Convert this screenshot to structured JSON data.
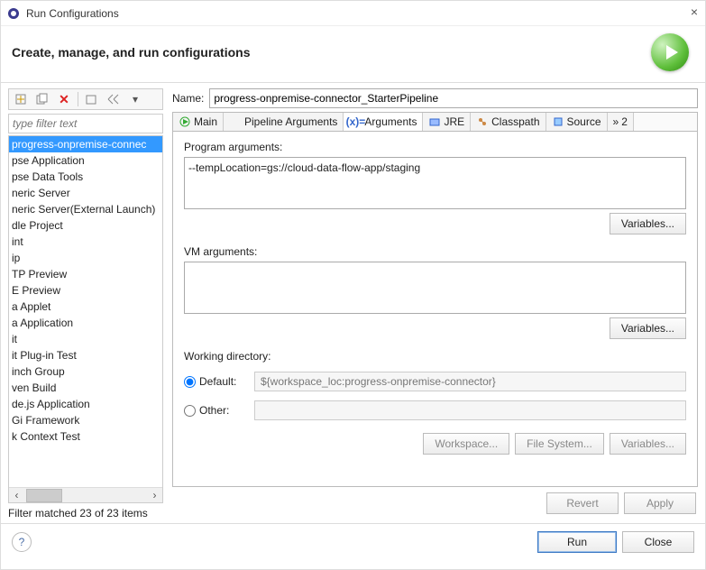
{
  "window": {
    "title": "Run Configurations",
    "close": "×"
  },
  "header": {
    "text": "Create, manage, and run configurations"
  },
  "toolbar_icons": {
    "new": "new-config-icon",
    "dup": "duplicate-icon",
    "del": "delete-icon",
    "col": "collapse-icon",
    "exp": "expand-icon",
    "filter": "filter-icon"
  },
  "filter": {
    "placeholder": "type filter text"
  },
  "tree": {
    "items": [
      "progress-onpremise-connec",
      "pse Application",
      "pse Data Tools",
      "neric Server",
      "neric Server(External Launch)",
      "dle Project",
      "int",
      "ip",
      "TP Preview",
      "E Preview",
      "a Applet",
      "a Application",
      "it",
      "it Plug-in Test",
      "inch Group",
      "ven Build",
      "de.js Application",
      "Gi Framework",
      "k Context Test"
    ],
    "selected_index": 0
  },
  "status": "Filter matched 23 of 23 items",
  "form": {
    "name_label": "Name:",
    "name_value": "progress-onpremise-connector_StarterPipeline"
  },
  "tabs": [
    {
      "label": "Main"
    },
    {
      "label": "Pipeline Arguments"
    },
    {
      "label": "Arguments"
    },
    {
      "label": "JRE"
    },
    {
      "label": "Classpath"
    },
    {
      "label": "Source"
    },
    {
      "label": "2",
      "overflow": true
    }
  ],
  "active_tab": 2,
  "args": {
    "program_label": "Program arguments:",
    "program_value": "--tempLocation=gs://cloud-data-flow-app/staging",
    "vm_label": "VM arguments:",
    "vm_value": "",
    "variables_btn": "Variables...",
    "workdir_label": "Working directory:",
    "default_radio": "Default:",
    "other_radio": "Other:",
    "default_value": "${workspace_loc:progress-onpremise-connector}",
    "workspace_btn": "Workspace...",
    "filesystem_btn": "File System...",
    "variables2_btn": "Variables..."
  },
  "bottom": {
    "revert": "Revert",
    "apply": "Apply"
  },
  "footer": {
    "help": "?",
    "run": "Run",
    "close": "Close"
  }
}
